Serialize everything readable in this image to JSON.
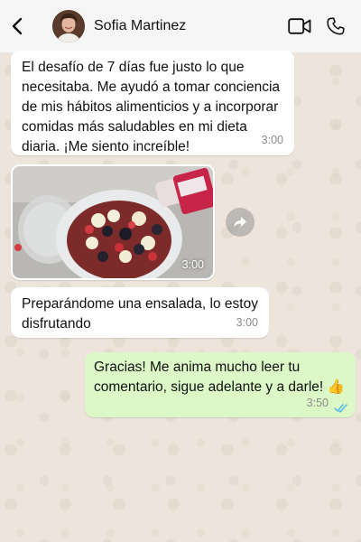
{
  "header": {
    "contact_name": "Sofia Martinez"
  },
  "messages": [
    {
      "direction": "incoming",
      "type": "text",
      "text": "El desafío de 7 días fue justo lo que necesitaba. Me ayudó a tomar conciencia de mis hábitos alimenticios y a incorporar comidas más saludables en mi dieta diaria. ¡Me siento increíble!",
      "time": "3:00"
    },
    {
      "direction": "incoming",
      "type": "image",
      "image_desc": "bowl of fruit salad with strawberries, blackberries and banana",
      "time": "3:00"
    },
    {
      "direction": "incoming",
      "type": "text",
      "text": "Preparándome una ensalada, lo estoy disfrutando",
      "time": "3:00"
    },
    {
      "direction": "outgoing",
      "type": "text",
      "text": "Gracias! Me anima mucho leer tu comentario, sigue adelante y a darle! 👍",
      "time": "3:50",
      "status": "read"
    }
  ],
  "colors": {
    "incoming_bubble": "#ffffff",
    "outgoing_bubble": "#dcf8c6",
    "read_ticks": "#4fb6ec",
    "chat_background": "#ede5dc"
  },
  "icons": [
    "back-arrow-icon",
    "video-call-icon",
    "phone-icon",
    "forward-icon",
    "double-check-icon"
  ]
}
